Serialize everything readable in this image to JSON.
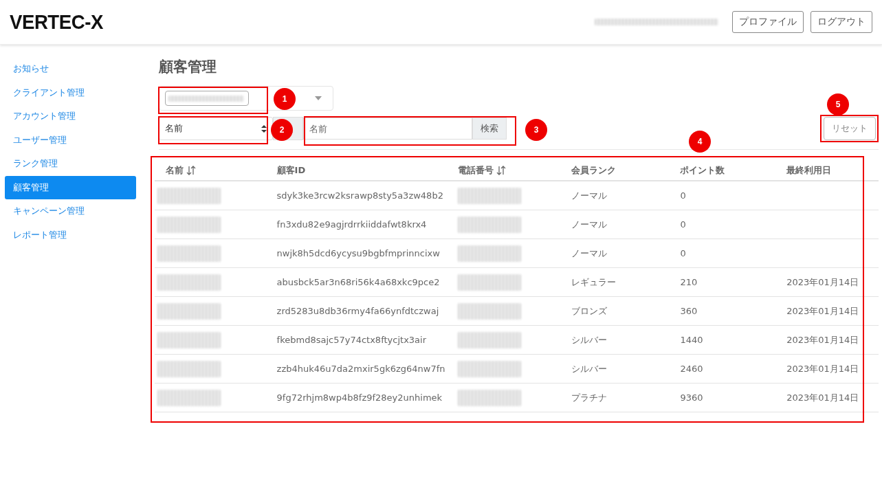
{
  "header": {
    "logo": "VERTEC-X",
    "buttons": [
      "プロファイル",
      "ログアウト"
    ]
  },
  "sidebar": {
    "items": [
      {
        "label": "お知らせ",
        "selected": false
      },
      {
        "label": "クライアント管理",
        "selected": false
      },
      {
        "label": "アカウント管理",
        "selected": false
      },
      {
        "label": "ユーザー管理",
        "selected": false
      },
      {
        "label": "ランク管理",
        "selected": false
      },
      {
        "label": "顧客管理",
        "selected": true
      },
      {
        "label": "キャンペーン管理",
        "selected": false
      },
      {
        "label": "レポート管理",
        "selected": false
      }
    ]
  },
  "page_title": "顧客管理",
  "filter": {
    "search_by": "名前",
    "search_placeholder": "名前",
    "search_button": "検索",
    "reset_button": "リセット"
  },
  "table": {
    "columns": [
      {
        "label": "名前",
        "sortable": true
      },
      {
        "label": "顧客ID",
        "sortable": false
      },
      {
        "label": "電話番号",
        "sortable": true
      },
      {
        "label": "会員ランク",
        "sortable": false
      },
      {
        "label": "ポイント数",
        "sortable": false
      },
      {
        "label": "最終利用日",
        "sortable": false
      }
    ],
    "rows": [
      {
        "customer_id": "sdyk3ke3rcw2ksrawp8sty5a3zw48b2",
        "rank": "ノーマル",
        "points": "0"
      },
      {
        "customer_id": "fn3xdu82e9agjrdrrkiiddafwt8krx4",
        "rank": "ノーマル",
        "points": "0"
      },
      {
        "customer_id": "nwjk8h5dcd6ycysu9bgbfmprinncixw",
        "rank": "ノーマル",
        "points": "0"
      },
      {
        "customer_id": "abusbck5ar3n68ri56k4a68xkc9pce2",
        "rank": "レギュラー",
        "points": "210",
        "last_used": "2023年01月14日"
      },
      {
        "customer_id": "zrd5283u8db36rmy4fa66ynfdtczwaj",
        "rank": "ブロンズ",
        "points": "360",
        "last_used": "2023年01月14日"
      },
      {
        "customer_id": "fkebmd8sajc57y74ctx8ftycjtx3air",
        "rank": "シルバー",
        "points": "1440",
        "last_used": "2023年01月14日"
      },
      {
        "customer_id": "zzb4huk46u7da2mxir5gk6zg64nw7fn",
        "rank": "シルバー",
        "points": "2460",
        "last_used": "2023年01月14日"
      },
      {
        "customer_id": "9fg72rhjm8wp4b8fz9f28ey2unhimek",
        "rank": "プラチナ",
        "points": "9360",
        "last_used": "2023年01月14日"
      }
    ]
  },
  "callouts": [
    "1",
    "2",
    "3",
    "4",
    "5"
  ]
}
